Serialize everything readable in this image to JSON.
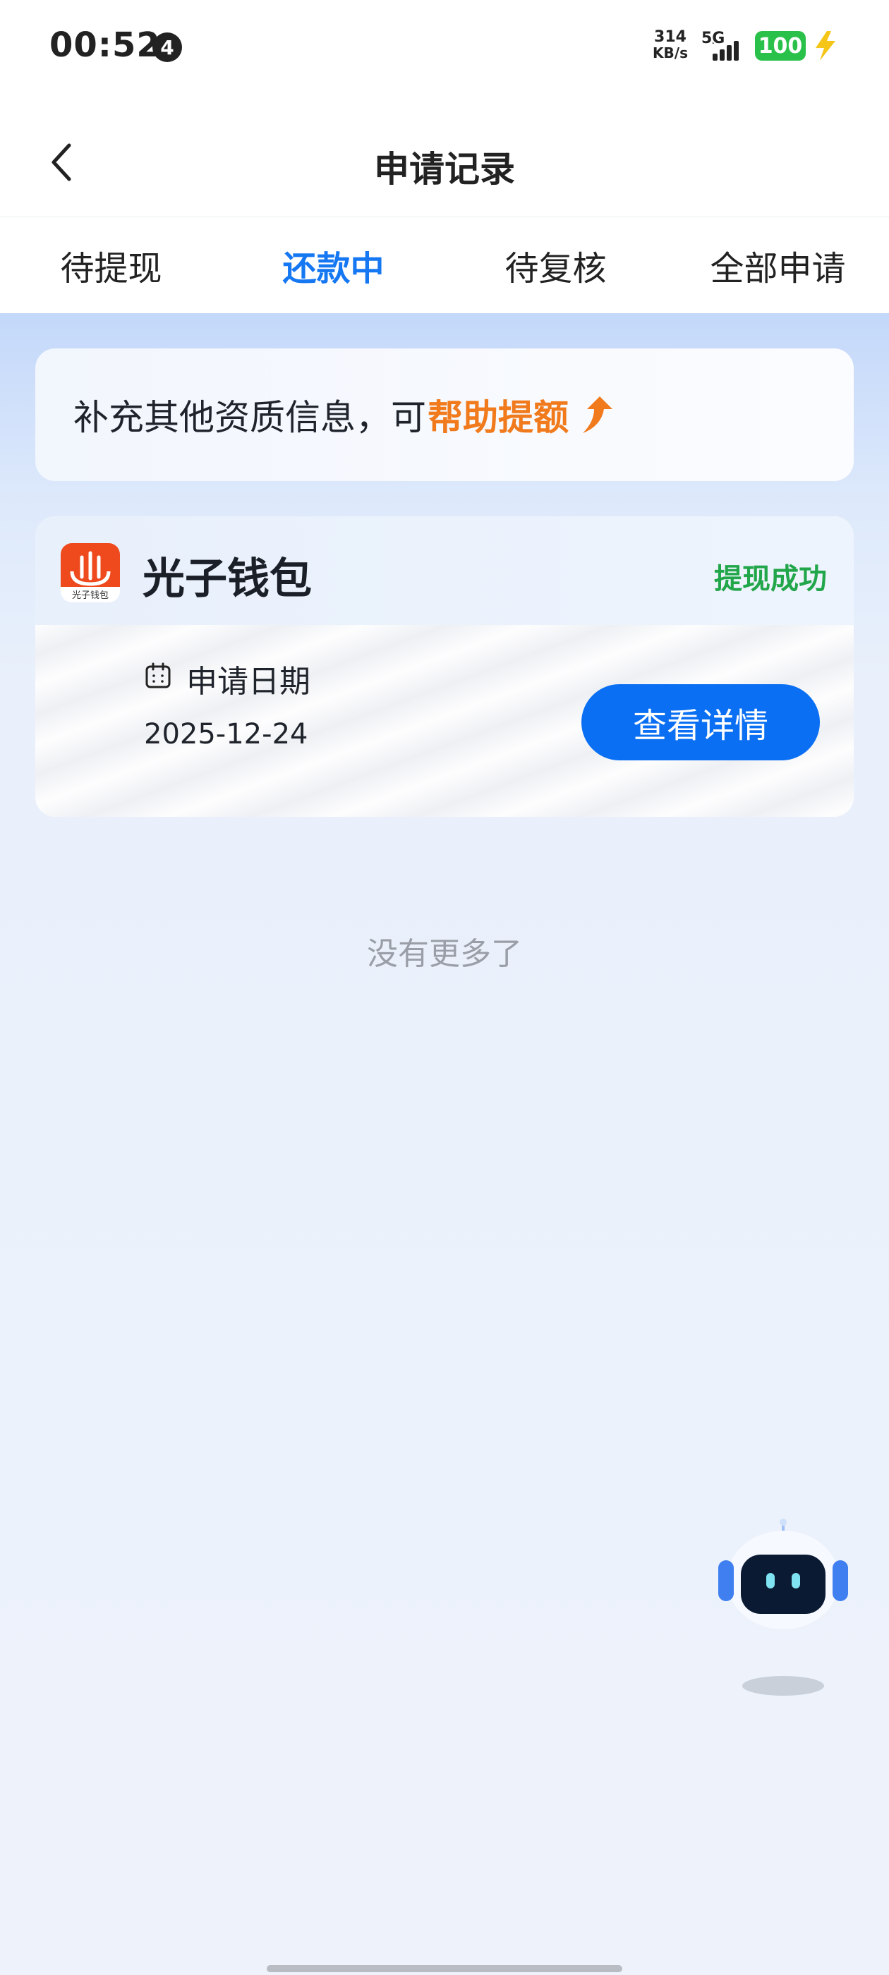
{
  "status_bar": {
    "time": "00:52",
    "notification_count": "4",
    "net_speed_value": "314",
    "net_speed_unit": "KB/s",
    "network_type": "5G",
    "battery": "100",
    "battery_color": "#2ac14a"
  },
  "header": {
    "title": "申请记录",
    "back_icon": "chevron-left-icon"
  },
  "tabs": [
    {
      "label": "待提现",
      "active": false
    },
    {
      "label": "还款中",
      "active": true
    },
    {
      "label": "待复核",
      "active": false
    },
    {
      "label": "全部申请",
      "active": false
    }
  ],
  "banner": {
    "text": "补充其他资质信息，可",
    "highlight": "帮助提额",
    "icon": "arrow-up-icon"
  },
  "record": {
    "app_name": "光子钱包",
    "logo_text": "光子钱包",
    "status": "提现成功",
    "date_label": "申请日期",
    "date_value": "2025-12-24",
    "detail_button": "查看详情"
  },
  "footer_text": "没有更多了",
  "colors": {
    "accent": "#1677f2",
    "button": "#0a6ff2",
    "highlight": "#f07a1c",
    "success": "#22a64a"
  }
}
